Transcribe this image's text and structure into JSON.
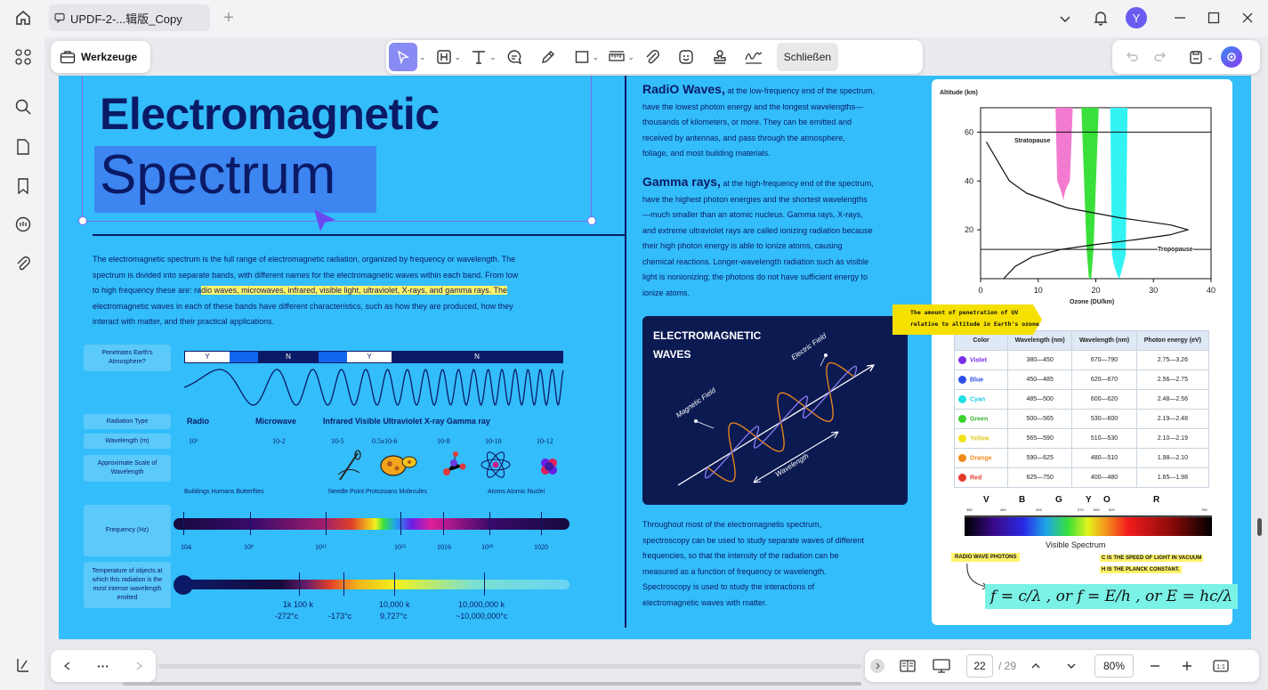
{
  "app": {
    "tab_title": "UPDF-2-...辑版_Copy",
    "user_initial": "Y",
    "brand_color": "#6a5cf0"
  },
  "toolbar": {
    "tools_label": "Werkzeuge",
    "close_label": "Schließen"
  },
  "page": {
    "title_line1": "Electromagnetic",
    "title_line2": "Spectrum",
    "intro_1": "The electromagnetic spectrum is the full range of electromagnetic radiation, organized by frequency or wavelength. The",
    "intro_2": "spectrum is divided into separate bands, with different names for the electromagnetic waves within each band. From low",
    "intro_3a": "to high frequency these are: ra",
    "intro_3b": "dio waves, microwaves, infrared, visible light, ultraviolet, X-rays, and gamma rays. The",
    "intro_4": "electromagnetic waves in each of these bands have different characteristics, such as how they are produced, how they",
    "intro_5": "interact with matter, and their practical applications.",
    "diagram": {
      "penetrates_label": "Penetrates Earth's Atmosphere?",
      "bar_y1": "Y",
      "bar_n1": "N",
      "bar_y2": "Y",
      "bar_n2": "N",
      "radiation_type_label": "Radiation Type",
      "radio": "Radio",
      "microwave": "Microwave",
      "others": "Infrared Visible Ultraviolet X-ray Gamma ray",
      "wavelength_label": "Wavelength (m)",
      "wavelengths": [
        "10³",
        "10-2",
        "10-5",
        "0.5x10-6",
        "10-8",
        "10-10",
        "10-12"
      ],
      "scale_label": "Approximate Scale of Wavelength",
      "scale_left": "Buildings Humans Butterflies",
      "scale_mid": "Needle Point Protozoans Molecules",
      "scale_right": "Atoms Atomic Nuclei",
      "frequency_label": "Frequency (Hz)",
      "frequencies": [
        "104",
        "10⁸",
        "10¹²",
        "10¹⁵",
        "1016",
        "10¹⁸",
        "1020"
      ],
      "temperature_label": "Temperature of objects at which this radiation is the most intense wavelength emitted",
      "temps_top": [
        "1k 100 k",
        "10,000 k",
        "10,000,000 k"
      ],
      "temps_bottom": [
        "-272°c",
        "-173°c",
        "9,727°c",
        "~10,000,000°c"
      ]
    },
    "radio_heading": "RadiO Waves,",
    "radio_1": " at the low-frequency end of the spectrum,",
    "radio_2": "have the lowest photon energy and the longest wavelengths—",
    "radio_3": "thousands of kilometers, or more. They can be emitted and",
    "radio_4": "received by antennas, and pass through the atmosphere,",
    "radio_5": "foliage, and most building materials.",
    "gamma_heading": "Gamma rays,",
    "gamma_1": " at the high-frequency end of the spectrum,",
    "gamma_2": "have the highest photon energies and the shortest wavelengths",
    "gamma_3": "—much smaller than an atomic nucleus. Gamma rays, X-rays,",
    "gamma_4": "and extreme ultraviolet rays are called ionizing radiation because",
    "gamma_5": "their high photon energy is able to ionize atoms, causing",
    "gamma_6": "chemical reactions. Longer-wavelength radiation such as visible",
    "gamma_7": "light is nonionizing; the photons do not have sufficient energy to",
    "gamma_8": "ionize atoms.",
    "em_card_title1": "ELECTROMAGNETIC",
    "em_card_title2": "WAVES",
    "em_electric": "Electric Field",
    "em_magnetic": "Magnetic Field",
    "em_wavelength": "Wavelength",
    "spec_1": "Throughout most of the electromagnetis spectrum,",
    "spec_2": "spectroscopy can be used to study separate waves of different",
    "spec_3": "frequencies, so that the intensity of the radiation can be",
    "spec_4": "measured as a function of frequency or wavelength.",
    "spec_5": "Spectroscopy is used to study the interactions of",
    "spec_6": "electromagnetic waves with matter.",
    "ozone_note_1": "The amount of penetration of UV",
    "ozone_note_2": "relative to altitude in Earth's ozone",
    "visible_spectrum_label": "Visible Spectrum",
    "vs_letters": [
      "V",
      "B",
      "G",
      "Y",
      "O",
      "R"
    ],
    "vs_ticks": [
      "380",
      "450",
      "495",
      "570",
      "590",
      "620",
      "750"
    ],
    "radio_photons": "RADIO WAVE PHOTONS",
    "c_note_1": "C IS THE SPEED OF LIGHT IN VACUUM",
    "c_note_2": "H IS THE PLANCK CONSTANT.",
    "formula": "f = c/λ , or f = E/h , or E = hc/λ"
  },
  "chart_data": {
    "type": "area",
    "title": "",
    "xlabel": "Ozone (DU/km)",
    "ylabel": "Altitude (km)",
    "xlim": [
      0,
      40
    ],
    "ylim": [
      0,
      70
    ],
    "xticks": [
      0,
      10,
      20,
      30,
      40
    ],
    "yticks": [
      20,
      40,
      60
    ],
    "annotations": [
      "Stratopause",
      "Tropopause"
    ],
    "stratopause_alt": 60,
    "tropopause_alt": 12,
    "ozone_profile": {
      "x": [
        4,
        6,
        9,
        14,
        20,
        27,
        33,
        36,
        33,
        24,
        15,
        8,
        5,
        3,
        1
      ],
      "y": [
        0,
        5,
        9,
        12,
        14,
        16,
        18,
        20,
        22,
        25,
        29,
        35,
        40,
        48,
        56
      ]
    }
  },
  "table": {
    "headers": [
      "Color",
      "Wavelength (nm)",
      "Wavelength (nm)",
      "Photon energy (eV)"
    ],
    "rows": [
      {
        "color": "Violet",
        "hex": "#7a2ee6",
        "w1": "380—450",
        "w2": "670—790",
        "e": "2.75—3.26"
      },
      {
        "color": "Blue",
        "hex": "#2e4fe6",
        "w1": "450—485",
        "w2": "620—670",
        "e": "2.56—2.75"
      },
      {
        "color": "Cyan",
        "hex": "#22e0e6",
        "w1": "485—500",
        "w2": "600—620",
        "e": "2.48—2.56"
      },
      {
        "color": "Green",
        "hex": "#3ad12e",
        "w1": "500—565",
        "w2": "530—600",
        "e": "2.19—2.48"
      },
      {
        "color": "Yellow",
        "hex": "#f2e21c",
        "w1": "565—590",
        "w2": "510—530",
        "e": "2.10—2.19"
      },
      {
        "color": "Orange",
        "hex": "#f28a1c",
        "w1": "590—625",
        "w2": "480—510",
        "e": "1.98—2.10"
      },
      {
        "color": "Red",
        "hex": "#e63a2e",
        "w1": "625—750",
        "w2": "400—480",
        "e": "1.65—1.98"
      }
    ]
  },
  "footer": {
    "more": "···",
    "page_current": "22",
    "page_total": "/ 29",
    "zoom": "80%"
  }
}
